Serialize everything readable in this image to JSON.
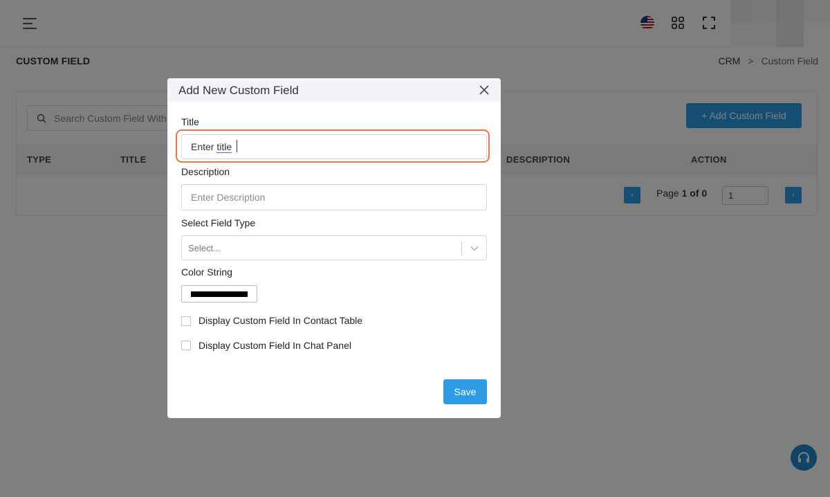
{
  "header": {
    "menu_icon": "hamburger-menu-icon",
    "flag_icon": "us-flag-icon",
    "apps_icon": "apps-grid-icon",
    "fullscreen_icon": "fullscreen-icon"
  },
  "page": {
    "title": "CUSTOM FIELD",
    "breadcrumb": {
      "root": "CRM",
      "separator": ">",
      "current": "Custom Field"
    }
  },
  "toolbar": {
    "search_placeholder": "Search Custom Field With Title",
    "add_button_label": "+ Add Custom Field"
  },
  "table": {
    "columns": [
      "TYPE",
      "TITLE",
      "DESCRIPTION",
      "ACTION"
    ]
  },
  "pagination": {
    "prefix": "Page",
    "current": "1",
    "of_label": "of",
    "total": "0",
    "page_input_value": "1",
    "prev_glyph": "‹",
    "next_glyph": "›"
  },
  "modal": {
    "title": "Add New Custom Field",
    "fields": {
      "title_label": "Title",
      "title_prefix": "Enter ",
      "title_word": "title",
      "description_label": "Description",
      "description_placeholder": "Enter Description",
      "field_type_label": "Select Field Type",
      "field_type_value": "Select...",
      "color_label": "Color String",
      "color_value": "#000000"
    },
    "checkboxes": [
      {
        "label": "Display Custom Field In Contact Table",
        "checked": false
      },
      {
        "label": "Display Custom Field In Chat Panel",
        "checked": false
      }
    ],
    "save_label": "Save"
  },
  "colors": {
    "primary": "#2d9be6",
    "focus_ring": "#f0743e",
    "overlay": "rgba(0,0,0,0.5)"
  }
}
